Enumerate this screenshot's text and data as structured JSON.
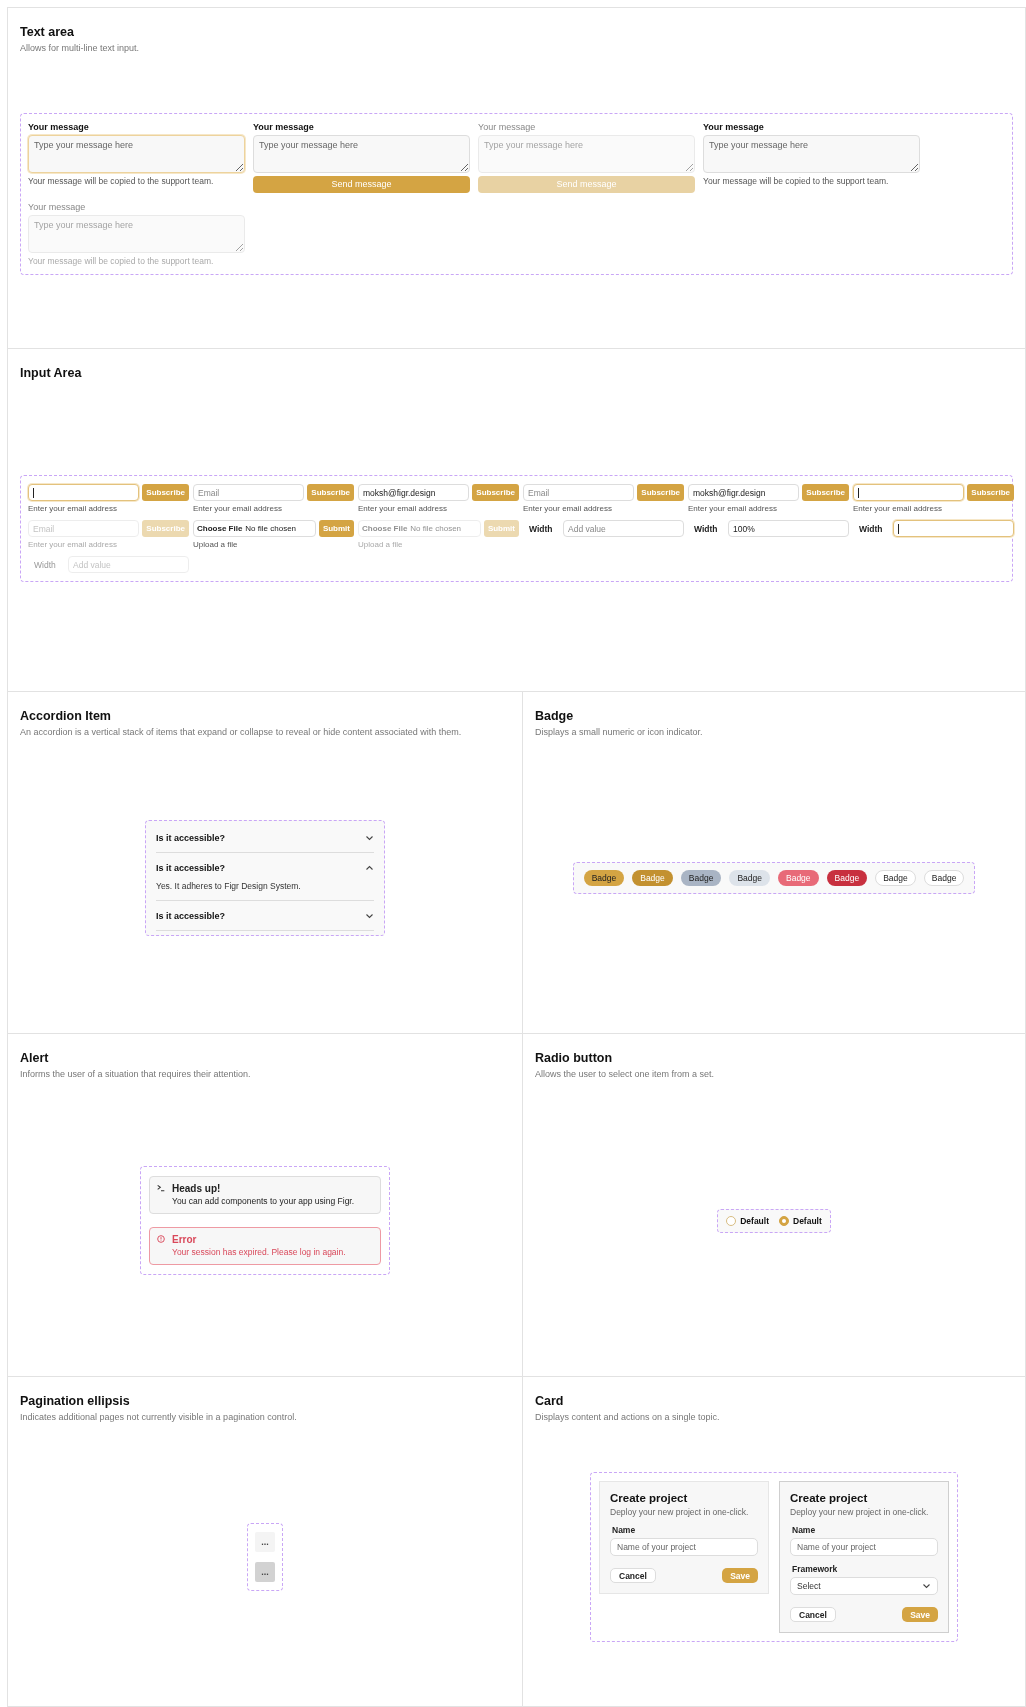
{
  "sections": [
    {
      "kind": "textarea",
      "title": "Text area",
      "description": "Allows for multi-line text input.",
      "examples": [
        {
          "label": "Your message",
          "placeholder": "Type your message here",
          "helper": "Your message will be copied to the support team.",
          "focused": true,
          "disabled": false
        },
        {
          "label": "Your message",
          "placeholder": "Type your message here",
          "button": "Send message",
          "focused": false,
          "disabled": false
        },
        {
          "label": "Your message",
          "placeholder": "Type your message here",
          "button": "Send message",
          "focused": false,
          "disabled": true
        },
        {
          "label": "Your message",
          "placeholder": "Type your message here",
          "helper": "Your message will be copied to the support team.",
          "focused": false,
          "disabled": false
        },
        {
          "label": "Your message",
          "placeholder": "Type your message here",
          "helper": "Your message will be copied to the support team.",
          "focused": false,
          "disabled": true
        }
      ]
    },
    {
      "kind": "input",
      "title": "Input Area",
      "examples": [
        {
          "kind": "email",
          "button": "Subscribe",
          "helper": "Enter your email address",
          "focused": true,
          "disabled": false
        },
        {
          "kind": "email",
          "placeholder": "Email",
          "button": "Subscribe",
          "helper": "Enter your email address",
          "focused": false,
          "disabled": false
        },
        {
          "kind": "email",
          "value": "moksh@figr.design",
          "button": "Subscribe",
          "helper": "Enter your email address",
          "focused": false,
          "disabled": false
        },
        {
          "kind": "email",
          "placeholder": "Email",
          "button": "Subscribe",
          "helper": "Enter your email address",
          "focused": false,
          "disabled": false
        },
        {
          "kind": "email",
          "value": "moksh@figr.design",
          "button": "Subscribe",
          "helper": "Enter your email address",
          "focused": false,
          "disabled": false
        },
        {
          "kind": "email",
          "button": "Subscribe",
          "helper": "Enter your email address",
          "focused": true,
          "disabled": false
        },
        {
          "kind": "email",
          "placeholder": "Email",
          "button": "Subscribe",
          "helper": "Enter your email address",
          "focused": false,
          "disabled": true
        },
        {
          "kind": "file",
          "choose": "Choose File",
          "status": "No file chosen",
          "button": "Submit",
          "helper": "Upload a file",
          "disabled": false
        },
        {
          "kind": "file",
          "choose": "Choose File",
          "status": "No file chosen",
          "button": "Submit",
          "helper": "Upload a file",
          "disabled": true
        },
        {
          "kind": "width",
          "label": "Width",
          "placeholder": "Add value",
          "focused": false,
          "disabled": false
        },
        {
          "kind": "width",
          "label": "Width",
          "value": "100%",
          "focused": false,
          "disabled": false
        },
        {
          "kind": "width",
          "label": "Width",
          "focused": true,
          "disabled": false
        },
        {
          "kind": "width",
          "label": "Width",
          "placeholder": "Add value",
          "focused": false,
          "disabled": true
        }
      ]
    },
    {
      "kind": "accordion",
      "title": "Accordion Item",
      "description": "An accordion is a vertical stack of items that expand or collapse to reveal or hide content associated with them.",
      "items": [
        {
          "question": "Is it accessible?",
          "expanded": false
        },
        {
          "question": "Is it accessible?",
          "expanded": true,
          "answer": "Yes. It adheres to Figr Design System."
        },
        {
          "question": "Is it accessible?",
          "expanded": false
        }
      ]
    },
    {
      "kind": "badge",
      "title": "Badge",
      "description": "Displays a small numeric or icon indicator.",
      "badges": [
        {
          "label": "Badge",
          "color": "#d4a443"
        },
        {
          "label": "Badge",
          "color": "#c39130"
        },
        {
          "label": "Badge",
          "color": "#a9b4c4"
        },
        {
          "label": "Badge",
          "color": "#dde3ea"
        },
        {
          "label": "Badge",
          "color": "#e86a78"
        },
        {
          "label": "Badge",
          "color": "#c8303f"
        },
        {
          "label": "Badge",
          "color": "#ffffff"
        },
        {
          "label": "Badge",
          "color": "#ffffff"
        }
      ]
    },
    {
      "kind": "alert",
      "title": "Alert",
      "description": "Informs the user of a situation that requires their attention.",
      "alerts": [
        {
          "kind": "default",
          "title": "Heads up!",
          "message": "You can add components to your app using Figr."
        },
        {
          "kind": "error",
          "title": "Error",
          "message": "Your session has expired. Please log in again."
        }
      ]
    },
    {
      "kind": "radio",
      "title": "Radio button",
      "description": "Allows the user to select one item from a set.",
      "options": [
        {
          "label": "Default",
          "selected": false
        },
        {
          "label": "Default",
          "selected": true
        }
      ]
    },
    {
      "kind": "pagination",
      "title": "Pagination ellipsis",
      "description": "Indicates additional pages not currently visible in a pagination control.",
      "buttons": [
        {
          "label": "...",
          "selected": false
        },
        {
          "label": "...",
          "selected": true
        }
      ]
    },
    {
      "kind": "card",
      "title": "Card",
      "description": "Displays content and actions on a single topic.",
      "cards": [
        {
          "title": "Create project",
          "description": "Deploy your new project in one-click.",
          "fields": [
            {
              "kind": "text",
              "label": "Name",
              "placeholder": "Name of your project"
            }
          ],
          "actions": [
            {
              "kind": "secondary",
              "label": "Cancel"
            },
            {
              "kind": "primary",
              "label": "Save"
            }
          ]
        },
        {
          "title": "Create project",
          "description": "Deploy your new project in one-click.",
          "fields": [
            {
              "kind": "text",
              "label": "Name",
              "placeholder": "Name of your project"
            },
            {
              "kind": "select",
              "label": "Framework",
              "value": "Select"
            }
          ],
          "actions": [
            {
              "kind": "secondary",
              "label": "Cancel"
            },
            {
              "kind": "primary",
              "label": "Save"
            }
          ]
        }
      ]
    }
  ]
}
